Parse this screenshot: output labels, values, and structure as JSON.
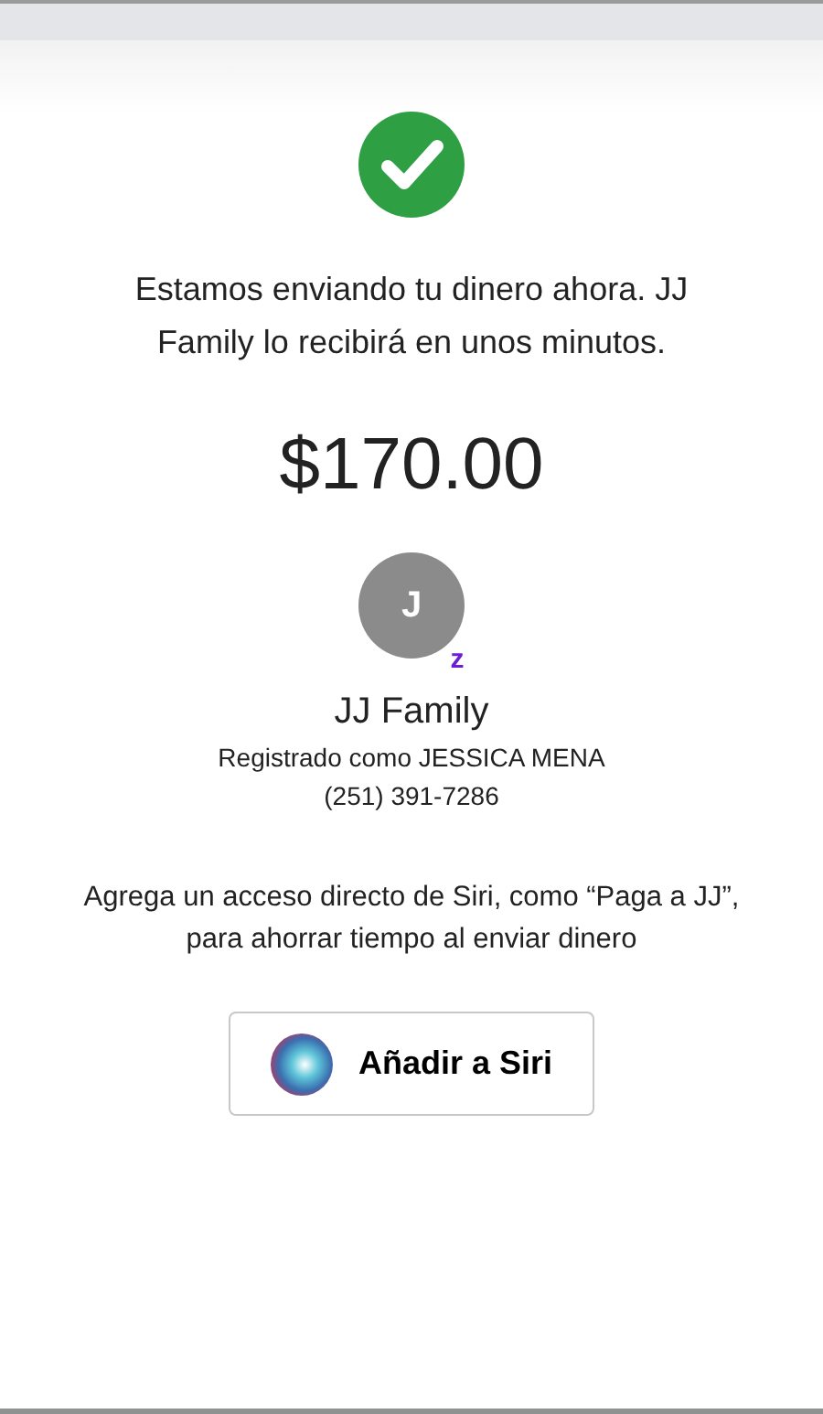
{
  "message": "Estamos enviando tu dinero ahora. JJ Family lo recibirá en unos minutos.",
  "amount": "$170.00",
  "recipient": {
    "initial": "J",
    "badge": "z",
    "name": "JJ Family",
    "registered": "Registrado como JESSICA MENA",
    "phone": "(251) 391-7286"
  },
  "siri_hint": "Agrega un acceso directo de Siri, como “Paga a JJ”, para ahorrar tiempo al enviar dinero",
  "siri_button": "Añadir a Siri"
}
